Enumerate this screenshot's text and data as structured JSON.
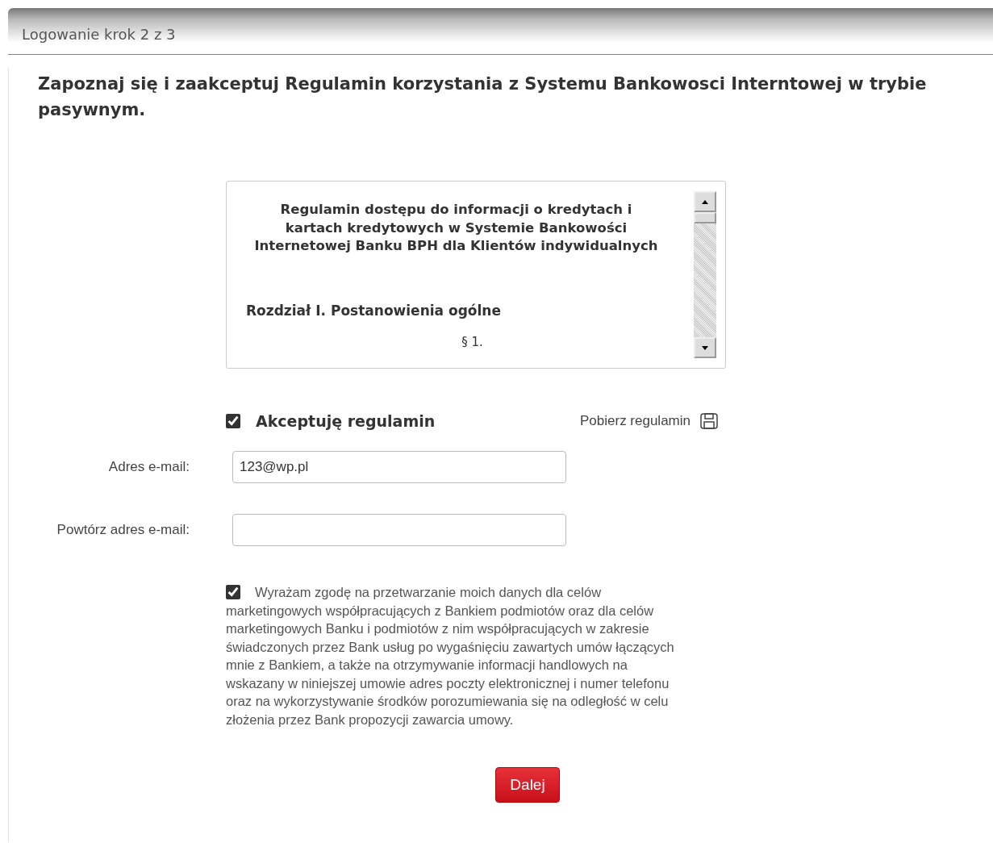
{
  "header": {
    "title": "Logowanie krok 2 z 3"
  },
  "heading": "Zapoznaj się i zaakceptuj Regulamin korzystania z Systemu Bankowosci Interntowej w trybie pasywnym.",
  "terms_box": {
    "title": "Regulamin dostępu do informacji o kredytach i kartach kredytowych w Systemie Bankowości Internetowej Banku BPH dla Klientów indywidualnych",
    "chapter": "Rozdział I. Postanowienia ogólne",
    "paragraph": "§ 1."
  },
  "accept": {
    "label": "Akceptuję regulamin",
    "checked": true
  },
  "download_link": "Pobierz regulamin",
  "fields": [
    {
      "label": "Adres e-mail:",
      "value": "123@wp.pl"
    },
    {
      "label": "Powtórz adres e-mail:"
    }
  ],
  "consent": {
    "text": "Wyrażam zgodę na przetwarzanie moich danych dla celów marketingowych współpracujących z Bankiem podmiotów oraz dla celów marketingowych Banku i podmiotów z nim współpracujących w zakresie świadczonych przez Bank usług po wygaśnięciu zawartych umów łączących mnie z Bankiem, a także na otrzymywanie informacji handlowych na wskazany w niniejszej umowie adres poczty elektronicznej i numer telefonu oraz na wykorzystywanie środków porozumiewania się na odległość w celu złożenia przez Bank propozycji zawarcia umowy.",
    "checked": true
  },
  "next_button": "Dalej"
}
